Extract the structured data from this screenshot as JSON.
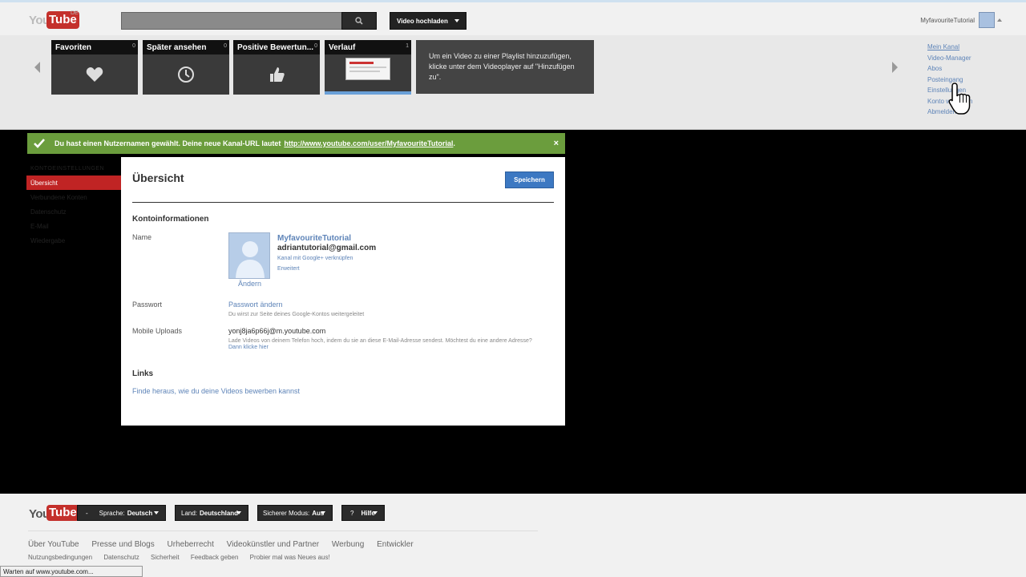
{
  "header": {
    "logo_text_you": "You",
    "logo_text_tube": "Tube",
    "logo_region": "DE",
    "upload_label": "Video hochladen",
    "user_name": "MyfavouriteTutorial"
  },
  "guide": {
    "tiles": [
      {
        "label": "Favoriten",
        "count": "0",
        "icon": "heart-icon"
      },
      {
        "label": "Später ansehen",
        "count": "0",
        "icon": "clock-icon"
      },
      {
        "label": "Positive Bewertun...",
        "count": "0",
        "icon": "thumbs-up-icon"
      },
      {
        "label": "Verlauf",
        "count": "1",
        "icon": "thumbnail"
      }
    ],
    "info_text": "Um ein Video zu einer Playlist hinzuzufügen, klicke unter dem Videoplayer auf \"Hinzufügen zu\".",
    "menu": [
      "Mein Kanal",
      "Video-Manager",
      "Abos",
      "Posteingang",
      "Einstellungen",
      "Konto wechseln",
      "Abmelden"
    ]
  },
  "notice": {
    "text": "Du hast einen Nutzernamen gewählt. Deine neue Kanal-URL lautet",
    "url": "http://www.youtube.com/user/MyfavouriteTutorial",
    "suffix": ".",
    "close": "×"
  },
  "left_nav": {
    "heading": "KONTOEINSTELLUNGEN",
    "items": [
      "Übersicht",
      "Verbundene Konten",
      "Datenschutz",
      "E-Mail",
      "Wiedergabe"
    ]
  },
  "panel": {
    "title": "Übersicht",
    "save_label": "Speichern",
    "account_heading": "Kontoinformationen",
    "name_label": "Name",
    "change_label": "Ändern",
    "channel_name": "MyfavouriteTutorial",
    "email": "adriantutorial@gmail.com",
    "link_google": "Kanal mit Google+ verknüpfen",
    "link_advanced": "Erweitert",
    "password_label": "Passwort",
    "password_link": "Passwort ändern",
    "password_hint": "Du wirst zur Seite deines Google-Kontos weitergeleitet",
    "mobile_label": "Mobile Uploads",
    "mobile_email": "yonj8ja6p66j@m.youtube.com",
    "mobile_hint": "Lade Videos von deinem Telefon hoch, indem du sie an diese E-Mail-Adresse sendest. Möchtest du eine andere Adresse?",
    "mobile_link": "Dann klicke hier",
    "links_heading": "Links",
    "promote_link": "Finde heraus, wie du deine Videos bewerben kannst"
  },
  "footer": {
    "language_label": "Sprache:",
    "language_value": "Deutsch",
    "country_label": "Land:",
    "country_value": "Deutschland",
    "safety_label": "Sicherer Modus:",
    "safety_value": "Aus",
    "help_label": "Hilfe",
    "help_prefix": "?",
    "dash": "-",
    "links": [
      "Über YouTube",
      "Presse und Blogs",
      "Urheberrecht",
      "Videokünstler und Partner",
      "Werbung",
      "Entwickler"
    ],
    "links2": [
      "Nutzungsbedingungen",
      "Datenschutz",
      "Sicherheit",
      "Feedback geben",
      "Probier mal was Neues aus!"
    ]
  },
  "statusbar": "Warten auf www.youtube.com..."
}
